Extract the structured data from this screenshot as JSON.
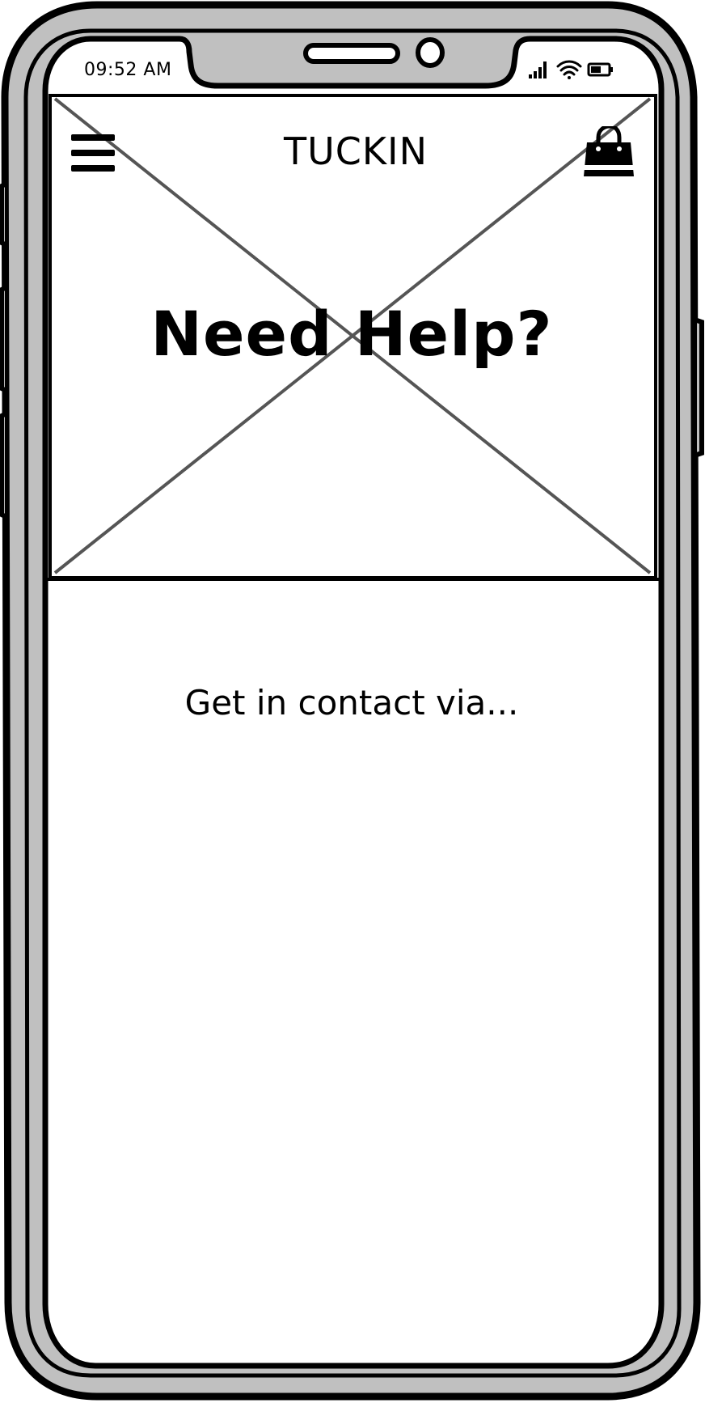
{
  "status_bar": {
    "time": "09:52 AM",
    "icons": [
      "cellular-signal-icon",
      "wifi-icon",
      "battery-icon"
    ]
  },
  "header": {
    "title": "TUCKIN",
    "menu_icon": "hamburger-menu-icon",
    "cart_icon": "shopping-bag-icon"
  },
  "hero": {
    "image": "image-placeholder",
    "title": "Need Help?"
  },
  "content": {
    "contact_text": "Get in contact via..."
  },
  "colors": {
    "device_frame": "#c0c0c0",
    "outline": "#000000",
    "placeholder_cross": "#555555",
    "screen": "#ffffff"
  }
}
